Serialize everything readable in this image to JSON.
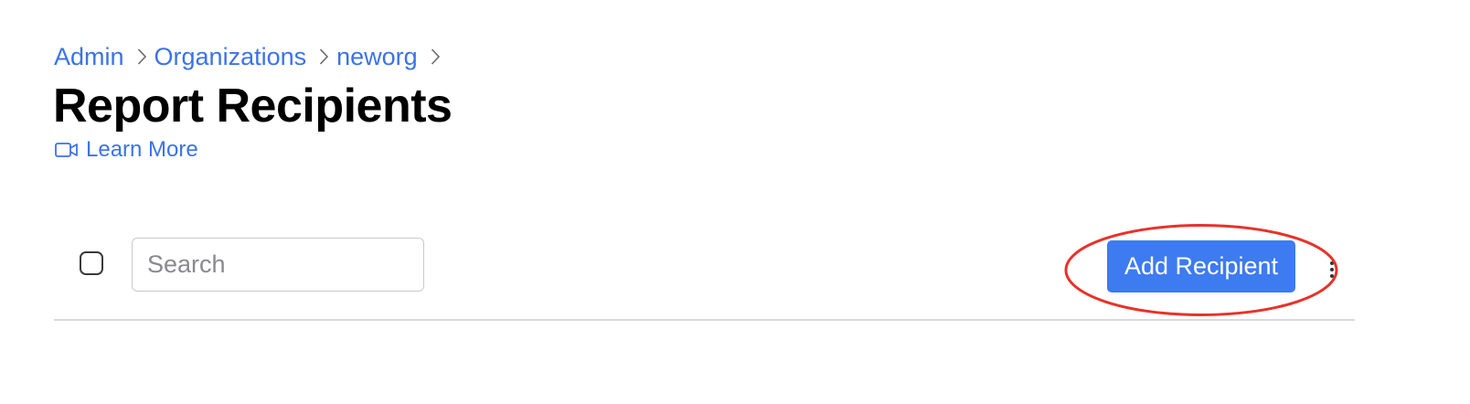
{
  "breadcrumb": {
    "items": [
      {
        "label": "Admin"
      },
      {
        "label": "Organizations"
      },
      {
        "label": "neworg"
      }
    ]
  },
  "page": {
    "title": "Report Recipients",
    "learn_more_label": "Learn More"
  },
  "toolbar": {
    "search_placeholder": "Search",
    "search_value": "",
    "add_button_label": "Add Recipient"
  },
  "colors": {
    "link": "#3b73e8",
    "primary_button": "#3d7bf0",
    "highlight_ellipse": "#e8322a"
  },
  "icons": {
    "breadcrumb_separator": "chevron-right-icon",
    "learn_more": "video-camera-icon",
    "more_menu": "vertical-ellipsis-icon"
  }
}
